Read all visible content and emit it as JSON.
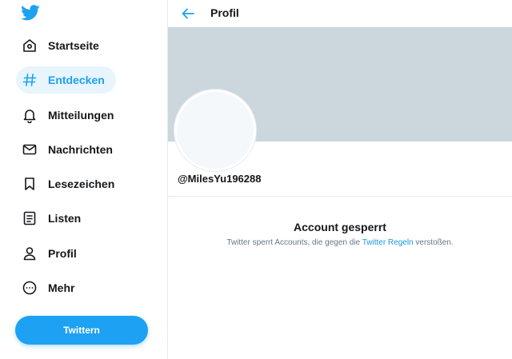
{
  "sidebar": {
    "logo_icon": "twitter-bird-icon",
    "items": [
      {
        "id": "startseite",
        "label": "Startseite",
        "icon": "home-icon"
      },
      {
        "id": "entdecken",
        "label": "Entdecken",
        "icon": "hashtag-icon",
        "active": true
      },
      {
        "id": "mitteilungen",
        "label": "Mitteilungen",
        "icon": "bell-icon"
      },
      {
        "id": "nachrichten",
        "label": "Nachrichten",
        "icon": "mail-icon"
      },
      {
        "id": "lesezeichen",
        "label": "Lesezeichen",
        "icon": "bookmark-icon"
      },
      {
        "id": "listen",
        "label": "Listen",
        "icon": "list-icon"
      },
      {
        "id": "profil",
        "label": "Profil",
        "icon": "person-icon"
      },
      {
        "id": "mehr",
        "label": "Mehr",
        "icon": "more-icon"
      }
    ],
    "tweet_button": "Twittern"
  },
  "header": {
    "back_icon": "arrow-left-icon",
    "title": "Profil"
  },
  "profile": {
    "handle": "@MilesYu196288"
  },
  "notice": {
    "title": "Account gesperrt",
    "text_before": "Twitter sperrt Accounts, die gegen die ",
    "link": "Twitter Regeln",
    "text_after": " verstoßen."
  },
  "colors": {
    "accent": "#1da1f2",
    "banner": "#ccd6dd",
    "active_bg": "#e8f5fd",
    "muted_text": "#657786"
  }
}
